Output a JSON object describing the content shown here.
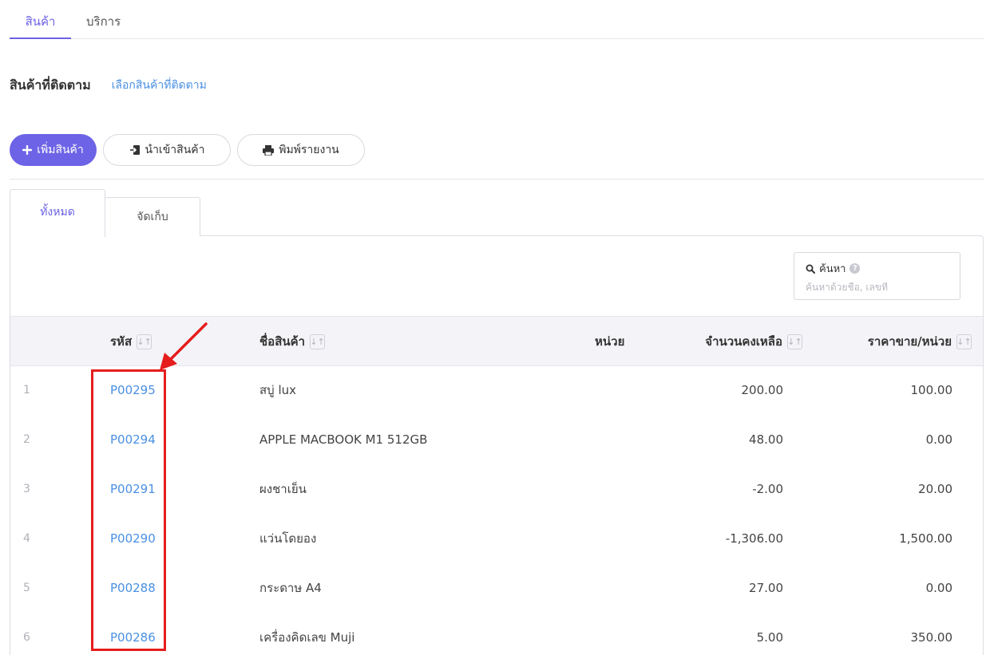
{
  "top_tabs": [
    {
      "label": "สินค้า",
      "active": true
    },
    {
      "label": "บริการ",
      "active": false
    }
  ],
  "followed": {
    "title": "สินค้าที่ติดตาม",
    "link": "เลือกสินค้าที่ติดตาม"
  },
  "actions": {
    "add": "เพิ่มสินค้า",
    "import": "นำเข้าสินค้า",
    "print": "พิมพ์รายงาน"
  },
  "sub_tabs": [
    {
      "label": "ทั้งหมด",
      "active": true
    },
    {
      "label": "จัดเก็บ",
      "active": false
    }
  ],
  "search": {
    "label": "ค้นหา",
    "placeholder": "ค้นหาด้วยชื่อ, เลขที่"
  },
  "table": {
    "headers": {
      "code": "รหัส",
      "name": "ชื่อสินค้า",
      "unit": "หน่วย",
      "qty": "จำนวนคงเหลือ",
      "price": "ราคาขาย/หน่วย"
    },
    "rows": [
      {
        "idx": "1",
        "code": "P00295",
        "name": "สบู่ lux",
        "unit": "",
        "qty": "200.00",
        "price": "100.00"
      },
      {
        "idx": "2",
        "code": "P00294",
        "name": "APPLE MACBOOK M1 512GB",
        "unit": "",
        "qty": "48.00",
        "price": "0.00"
      },
      {
        "idx": "3",
        "code": "P00291",
        "name": "ผงชาเย็น",
        "unit": "",
        "qty": "-2.00",
        "price": "20.00"
      },
      {
        "idx": "4",
        "code": "P00290",
        "name": "แว่นโดยอง",
        "unit": "",
        "qty": "-1,306.00",
        "price": "1,500.00"
      },
      {
        "idx": "5",
        "code": "P00288",
        "name": "กระดาษ A4",
        "unit": "",
        "qty": "27.00",
        "price": "0.00"
      },
      {
        "idx": "6",
        "code": "P00286",
        "name": "เครื่องคิดเลข Muji",
        "unit": "",
        "qty": "5.00",
        "price": "350.00"
      }
    ]
  },
  "colors": {
    "accent": "#6d63e6",
    "link": "#4a90e2",
    "annotation": "#e51d1d"
  }
}
